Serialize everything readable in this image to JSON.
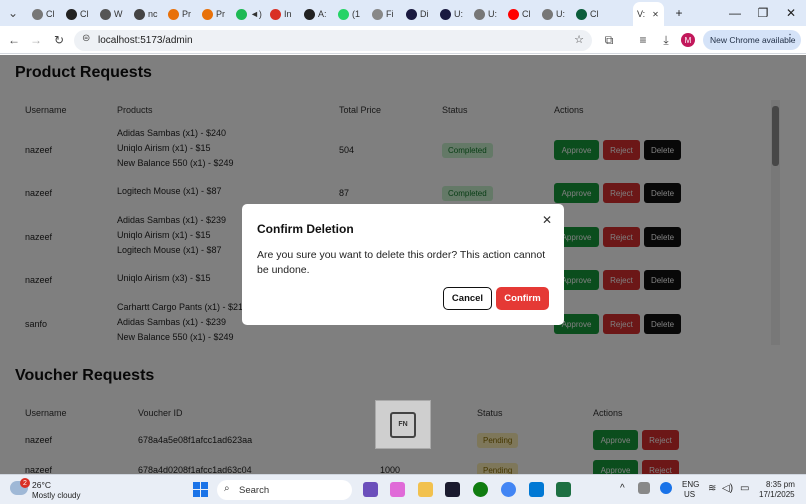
{
  "browser": {
    "tabs": [
      {
        "label": "Cl",
        "color": "#777777"
      },
      {
        "label": "Cl",
        "color": "#222222"
      },
      {
        "label": "W",
        "color": "#555555"
      },
      {
        "label": "nc",
        "color": "#444444"
      },
      {
        "label": "Pr",
        "color": "#e8710a"
      },
      {
        "label": "Pr",
        "color": "#e8710a"
      },
      {
        "label": "◄)",
        "color": "#1db954"
      },
      {
        "label": "In",
        "color": "#d93025"
      },
      {
        "label": "A:",
        "color": "#222222"
      },
      {
        "label": "(1",
        "color": "#25d366"
      },
      {
        "label": "Fi",
        "color": "#888888"
      },
      {
        "label": "Di",
        "color": "#1a1a40"
      },
      {
        "label": "U:",
        "color": "#1a1a40"
      },
      {
        "label": "U:",
        "color": "#777777"
      },
      {
        "label": "Cl",
        "color": "#ff0000"
      },
      {
        "label": "U:",
        "color": "#777777"
      },
      {
        "label": "Cl",
        "color": "#0b5d3b"
      }
    ],
    "active_tab": {
      "label": "V:",
      "close": "✕"
    },
    "new_tab": "+",
    "url": "localhost:5173/admin",
    "chrome_button": "New Chrome available",
    "avatar_letter": "M"
  },
  "product_requests": {
    "title": "Product Requests",
    "headers": [
      "Username",
      "Products",
      "Total Price",
      "Status",
      "Actions"
    ],
    "rows": [
      {
        "username": "nazeef",
        "products": [
          "Adidas Sambas (x1) - $240",
          "Uniqlo Airism (x1) - $15",
          "New Balance 550 (x1) - $249"
        ],
        "total": "504",
        "status": "Completed"
      },
      {
        "username": "nazeef",
        "products": [
          "Logitech Mouse (x1) - $87"
        ],
        "total": "87",
        "status": "Completed"
      },
      {
        "username": "nazeef",
        "products": [
          "Adidas Sambas (x1) - $239",
          "Uniqlo Airism (x1) - $15",
          "Logitech Mouse (x1) - $87"
        ],
        "total": "",
        "status": ""
      },
      {
        "username": "nazeef",
        "products": [
          "Uniqlo Airism (x3) - $15"
        ],
        "total": "",
        "status": ""
      },
      {
        "username": "sanfo",
        "products": [
          "Carhartt Cargo Pants (x1) - $219",
          "Adidas Sambas (x1) - $239",
          "New Balance 550 (x1) - $249"
        ],
        "total": "",
        "status": ""
      }
    ],
    "actions": {
      "approve": "Approve",
      "reject": "Reject",
      "delete": "Delete"
    }
  },
  "voucher_requests": {
    "title": "Voucher Requests",
    "headers": [
      "Username",
      "Voucher ID",
      "Status",
      "Actions"
    ],
    "rows": [
      {
        "username": "nazeef",
        "voucher_id": "678a4a5e08f1afcc1ad623aa",
        "amount": "",
        "status": "Pending"
      },
      {
        "username": "nazeef",
        "voucher_id": "678a4d0208f1afcc1ad63c04",
        "amount": "1000",
        "status": "Pending"
      }
    ]
  },
  "dialog": {
    "title": "Confirm Deletion",
    "message": "Are you sure you want to delete this order? This action cannot be undone.",
    "cancel": "Cancel",
    "confirm": "Confirm",
    "close": "✕"
  },
  "fn_overlay": {
    "label": "FN"
  },
  "taskbar": {
    "weather_temp": "26°C",
    "weather_desc": "Mostly cloudy",
    "weather_badge": "2",
    "search_label": "Search",
    "lang_top": "ENG",
    "lang_bottom": "US",
    "time": "8:35 pm",
    "date": "17/1/2025"
  }
}
